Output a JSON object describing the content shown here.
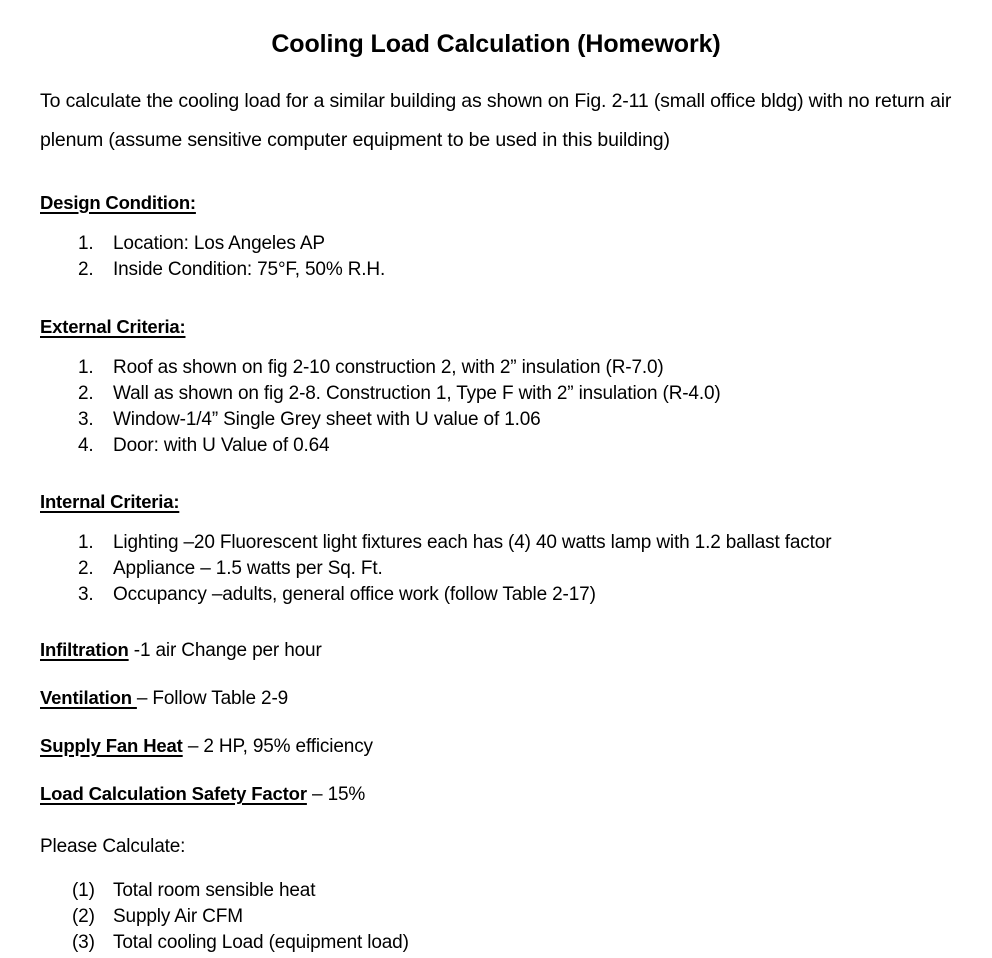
{
  "document": {
    "title": "Cooling Load Calculation (Homework)",
    "intro": "To calculate the cooling load for a similar building as shown on Fig. 2-11 (small office bldg) with no return air plenum (assume sensitive computer equipment to be used in this building)",
    "sections": {
      "design_condition": {
        "heading": "Design Condition:",
        "items": [
          {
            "marker": "1.",
            "text": "Location: Los Angeles AP"
          },
          {
            "marker": "2.",
            "text": "Inside Condition: 75°F, 50% R.H."
          }
        ]
      },
      "external_criteria": {
        "heading": "External Criteria:",
        "items": [
          {
            "marker": "1.",
            "text": "Roof as shown on fig 2-10 construction 2, with 2” insulation (R-7.0)"
          },
          {
            "marker": "2.",
            "text": "Wall as shown on fig 2-8. Construction 1, Type F with 2” insulation (R-4.0)"
          },
          {
            "marker": "3.",
            "text": "Window-1/4” Single Grey sheet with U value of 1.06"
          },
          {
            "marker": "4.",
            "text": "Door: with U Value of 0.64"
          }
        ]
      },
      "internal_criteria": {
        "heading": "Internal Criteria:",
        "items": [
          {
            "marker": "1.",
            "text": "Lighting –20 Fluorescent light fixtures each has (4) 40 watts lamp with 1.2 ballast factor"
          },
          {
            "marker": "2.",
            "text": "Appliance – 1.5 watts per Sq. Ft."
          },
          {
            "marker": "3.",
            "text": "Occupancy –adults, general office work (follow Table 2-17)"
          }
        ]
      }
    },
    "criteria_lines": {
      "infiltration": {
        "heading": "Infiltration",
        "value": " -1 air Change per hour"
      },
      "ventilation": {
        "heading": "Ventilation ",
        "value": "– Follow Table 2-9"
      },
      "supply_fan_heat": {
        "heading": "Supply Fan Heat",
        "value": " – 2 HP, 95% efficiency"
      },
      "load_safety_factor": {
        "heading": "Load Calculation Safety Factor",
        "value": " – 15%"
      }
    },
    "please_calculate": {
      "heading": "Please Calculate:",
      "items": [
        {
          "marker": "(1)",
          "text": "Total room sensible heat"
        },
        {
          "marker": "(2)",
          "text": "Supply Air CFM"
        },
        {
          "marker": "(3)",
          "text": "Total cooling Load (equipment load)"
        }
      ]
    }
  }
}
